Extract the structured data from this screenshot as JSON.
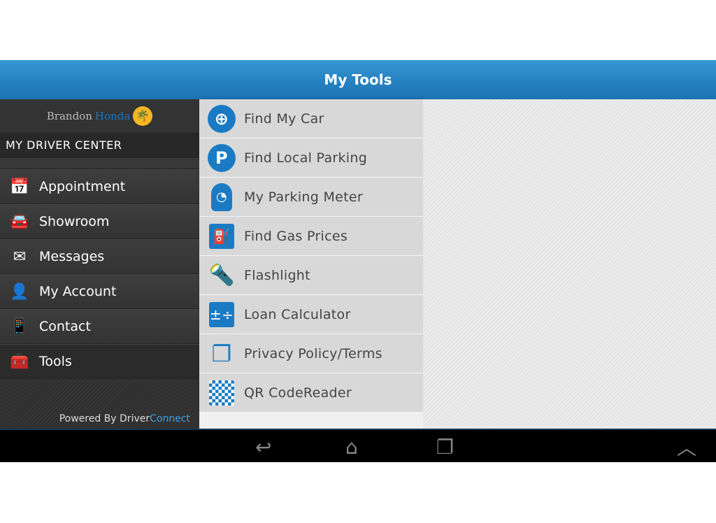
{
  "header": {
    "title": "My Tools"
  },
  "sidebar": {
    "logo": {
      "brand1": "Brandon",
      "brand2": "Honda"
    },
    "section_title": "MY DRIVER CENTER",
    "items": [
      {
        "label": "Appointment",
        "icon": "calendar-icon"
      },
      {
        "label": "Showroom",
        "icon": "car-icon"
      },
      {
        "label": "Messages",
        "icon": "envelope-icon"
      },
      {
        "label": "My Account",
        "icon": "user-icon"
      },
      {
        "label": "Contact",
        "icon": "contact-icon"
      },
      {
        "label": "Tools",
        "icon": "toolbox-icon",
        "active": true
      }
    ],
    "powered_by": "Powered By Driver",
    "powered_brand": "Connect"
  },
  "tools": [
    {
      "label": "Find My Car",
      "icon": "find-car-icon"
    },
    {
      "label": "Find Local Parking",
      "icon": "parking-icon"
    },
    {
      "label": "My Parking Meter",
      "icon": "parking-meter-icon"
    },
    {
      "label": "Find Gas Prices",
      "icon": "gas-pump-icon"
    },
    {
      "label": "Flashlight",
      "icon": "flashlight-icon"
    },
    {
      "label": "Loan Calculator",
      "icon": "calculator-icon"
    },
    {
      "label": "Privacy Policy/Terms",
      "icon": "document-icon"
    },
    {
      "label": "QR CodeReader",
      "icon": "qr-code-icon"
    }
  ],
  "colors": {
    "accent": "#1a7bc4",
    "header": "#2585c6"
  }
}
